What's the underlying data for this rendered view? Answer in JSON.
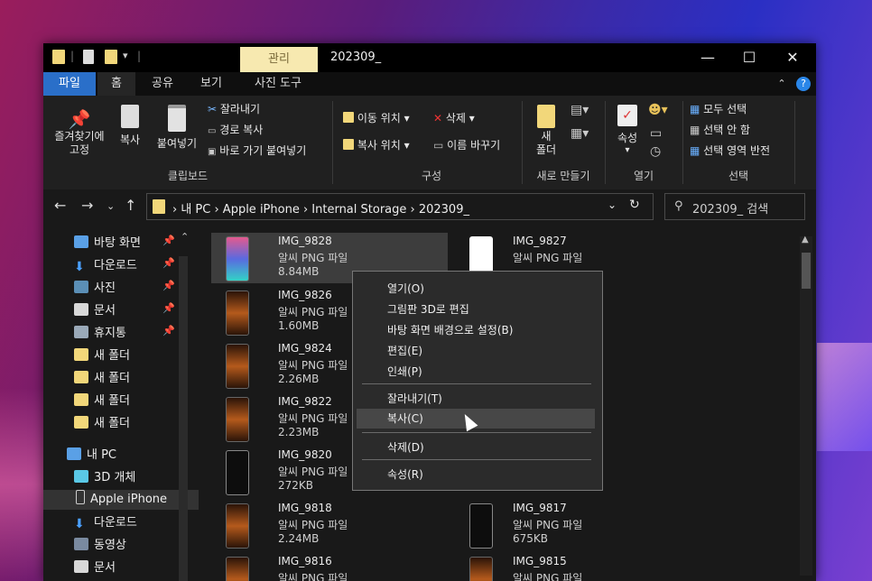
{
  "titlebar": {
    "manage_tab": "관리",
    "title": "202309_",
    "controls": {
      "minimize": "—",
      "maximize": "☐",
      "close": "✕"
    }
  },
  "tabs": [
    "파일",
    "홈",
    "공유",
    "보기",
    "사진 도구"
  ],
  "ribbon": {
    "pin_label": "즐겨찾기에\n고정",
    "copy": "복사",
    "paste": "붙여넣기",
    "cut": "잘라내기",
    "copy_path": "경로 복사",
    "paste_shortcut": "바로 가기 붙여넣기",
    "clipboard_group": "클립보드",
    "move_to": "이동 위치",
    "copy_to": "복사 위치",
    "delete": "삭제",
    "rename": "이름 바꾸기",
    "organize_group": "구성",
    "new_folder": "새\n폴더",
    "new_group": "새로 만들기",
    "properties": "속성",
    "open_group": "열기",
    "select_all": "모두 선택",
    "select_none": "선택 안 함",
    "invert_selection": "선택 영역 반전",
    "select_group": "선택"
  },
  "address": {
    "crumbs": "›  내 PC  ›  Apple iPhone  ›  Internal Storage  ›  202309_",
    "search_placeholder": "202309_ 검색"
  },
  "navpane": {
    "items": [
      {
        "label": "바탕 화면",
        "pinned": true
      },
      {
        "label": "다운로드",
        "pinned": true
      },
      {
        "label": "사진",
        "pinned": true
      },
      {
        "label": "문서",
        "pinned": true
      },
      {
        "label": "휴지통",
        "pinned": true
      },
      {
        "label": "새 폴더",
        "pinned": false
      },
      {
        "label": "새 폴더",
        "pinned": false
      },
      {
        "label": "새 폴더",
        "pinned": false
      },
      {
        "label": "새 폴더",
        "pinned": false
      },
      {
        "label": "내 PC",
        "pinned": false
      },
      {
        "label": "3D 개체",
        "pinned": false
      },
      {
        "label": "Apple iPhone",
        "pinned": false
      },
      {
        "label": "다운로드",
        "pinned": false
      },
      {
        "label": "동영상",
        "pinned": false
      },
      {
        "label": "문서",
        "pinned": false
      }
    ],
    "pin_glyph": "📌"
  },
  "files": {
    "left": [
      {
        "name": "IMG_9828",
        "type": "알씨 PNG 파일",
        "size": "8.84MB"
      },
      {
        "name": "IMG_9826",
        "type": "알씨 PNG 파일",
        "size": "1.60MB"
      },
      {
        "name": "IMG_9824",
        "type": "알씨 PNG 파일",
        "size": "2.26MB"
      },
      {
        "name": "IMG_9822",
        "type": "알씨 PNG 파일",
        "size": "2.23MB"
      },
      {
        "name": "IMG_9820",
        "type": "알씨 PNG 파일",
        "size": "272KB"
      },
      {
        "name": "IMG_9818",
        "type": "알씨 PNG 파일",
        "size": "2.24MB"
      },
      {
        "name": "IMG_9816",
        "type": "알씨 PNG 파일",
        "size": ""
      }
    ],
    "right": [
      {
        "name": "IMG_9827",
        "type": "알씨 PNG 파일",
        "size": ""
      },
      {
        "name": "IMG_9817",
        "type": "알씨 PNG 파일",
        "size": "675KB"
      },
      {
        "name": "IMG_9815",
        "type": "알씨 PNG 파일",
        "size": ""
      }
    ]
  },
  "context_menu": {
    "open": "열기(O)",
    "edit_3d": "그림판 3D로 편집",
    "set_background": "바탕 화면 배경으로 설정(B)",
    "edit": "편집(E)",
    "print": "인쇄(P)",
    "cut": "잘라내기(T)",
    "copy": "복사(C)",
    "delete": "삭제(D)",
    "properties": "속성(R)"
  }
}
